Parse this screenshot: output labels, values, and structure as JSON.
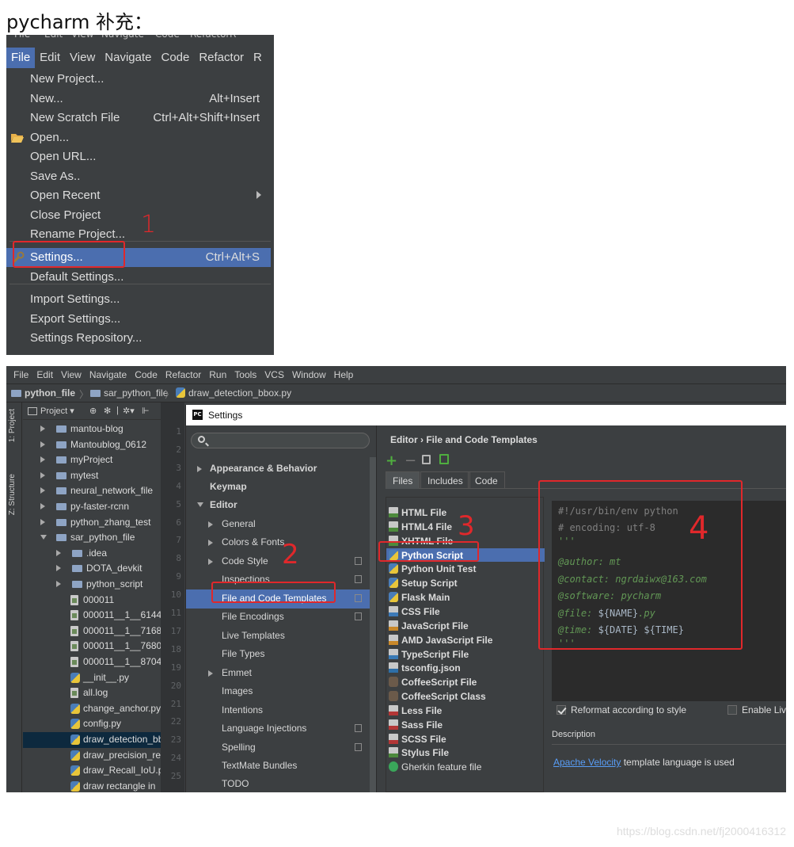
{
  "heading": "pycharm 补充：",
  "menu": {
    "strip_fragments": [
      "File",
      "Edit",
      "View",
      "Navigate",
      "Code",
      "Refactor",
      "R"
    ],
    "bar": [
      "File",
      "Edit",
      "View",
      "Navigate",
      "Code",
      "Refactor",
      "R"
    ],
    "items": [
      {
        "label": "New Project...",
        "shortcut": ""
      },
      {
        "label": "New...",
        "shortcut": "Alt+Insert"
      },
      {
        "label": "New Scratch File",
        "shortcut": "Ctrl+Alt+Shift+Insert"
      },
      {
        "label": "Open...",
        "shortcut": ""
      },
      {
        "label": "Open URL...",
        "shortcut": ""
      },
      {
        "label": "Save As..",
        "shortcut": ""
      },
      {
        "label": "Open Recent",
        "shortcut": ""
      },
      {
        "label": "Close Project",
        "shortcut": ""
      },
      {
        "label": "Rename Project...",
        "shortcut": ""
      },
      {
        "label": "Settings...",
        "shortcut": "Ctrl+Alt+S"
      },
      {
        "label": "Default Settings...",
        "shortcut": ""
      },
      {
        "label": "Import Settings...",
        "shortcut": ""
      },
      {
        "label": "Export Settings...",
        "shortcut": ""
      },
      {
        "label": "Settings Repository...",
        "shortcut": ""
      }
    ]
  },
  "annotations": {
    "a1": "1",
    "a2": "2",
    "a3": "3",
    "a4": "4"
  },
  "ide": {
    "menubar": [
      "File",
      "Edit",
      "View",
      "Navigate",
      "Code",
      "Refactor",
      "Run",
      "Tools",
      "VCS",
      "Window",
      "Help"
    ],
    "breadcrumb": [
      "python_file",
      "sar_python_file",
      "draw_detection_bbox.py"
    ],
    "side_tabs": [
      "1: Project",
      "Z: Structure"
    ],
    "project_toolbar": "Project ▾",
    "tree": [
      {
        "name": "mantou-blog",
        "kind": "folder",
        "indent": 0,
        "open": false
      },
      {
        "name": "Mantoublog_0612",
        "kind": "folder",
        "indent": 0,
        "open": false
      },
      {
        "name": "myProject",
        "kind": "folder",
        "indent": 0,
        "open": false
      },
      {
        "name": "mytest",
        "kind": "folder",
        "indent": 0,
        "open": false
      },
      {
        "name": "neural_network_file",
        "kind": "folder",
        "indent": 0,
        "open": false
      },
      {
        "name": "py-faster-rcnn",
        "kind": "folder",
        "indent": 0,
        "open": false
      },
      {
        "name": "python_zhang_test",
        "kind": "folder",
        "indent": 0,
        "open": false
      },
      {
        "name": "sar_python_file",
        "kind": "folder",
        "indent": 0,
        "open": true
      },
      {
        "name": ".idea",
        "kind": "folder",
        "indent": 1,
        "open": false
      },
      {
        "name": "DOTA_devkit",
        "kind": "folder",
        "indent": 1,
        "open": false
      },
      {
        "name": "python_script",
        "kind": "folder",
        "indent": 1,
        "open": false
      },
      {
        "name": "000011",
        "kind": "file",
        "indent": 1
      },
      {
        "name": "000011__1__6144_",
        "kind": "file",
        "indent": 1
      },
      {
        "name": "000011__1__7168_",
        "kind": "file",
        "indent": 1
      },
      {
        "name": "000011__1__7680_",
        "kind": "file",
        "indent": 1
      },
      {
        "name": "000011__1__8704_",
        "kind": "file",
        "indent": 1
      },
      {
        "name": "__init__.py",
        "kind": "py",
        "indent": 1
      },
      {
        "name": "all.log",
        "kind": "file",
        "indent": 1
      },
      {
        "name": "change_anchor.py",
        "kind": "py",
        "indent": 1
      },
      {
        "name": "config.py",
        "kind": "py",
        "indent": 1
      },
      {
        "name": "draw_detection_bb",
        "kind": "py",
        "indent": 1,
        "selected": true
      },
      {
        "name": "draw_precision_re",
        "kind": "py",
        "indent": 1
      },
      {
        "name": "draw_Recall_IoU.p",
        "kind": "py",
        "indent": 1
      },
      {
        "name": "draw rectangle in",
        "kind": "py",
        "indent": 1
      }
    ],
    "gutter": [
      "1",
      "2",
      "3",
      "4",
      "5",
      "6",
      "7",
      "8",
      "9",
      "10",
      "11",
      "17",
      "18",
      "19",
      "20",
      "21",
      "22",
      "23",
      "24",
      "25"
    ]
  },
  "settings": {
    "title": "Settings",
    "search_placeholder": "",
    "nav": [
      {
        "label": "Appearance & Behavior",
        "level": 0,
        "bold": true,
        "arrow": "r"
      },
      {
        "label": "Keymap",
        "level": 0,
        "bold": true
      },
      {
        "label": "Editor",
        "level": 0,
        "bold": true,
        "arrow": "d"
      },
      {
        "label": "General",
        "level": 1,
        "arrow": "r"
      },
      {
        "label": "Colors & Fonts",
        "level": 1,
        "arrow": "r"
      },
      {
        "label": "Code Style",
        "level": 1,
        "arrow": "r",
        "copy": true
      },
      {
        "label": "Inspections",
        "level": 1,
        "copy": true
      },
      {
        "label": "File and Code Templates",
        "level": 1,
        "copy": true,
        "selected": true
      },
      {
        "label": "File Encodings",
        "level": 1,
        "copy": true
      },
      {
        "label": "Live Templates",
        "level": 1
      },
      {
        "label": "File Types",
        "level": 1
      },
      {
        "label": "Emmet",
        "level": 1,
        "arrow": "r"
      },
      {
        "label": "Images",
        "level": 1
      },
      {
        "label": "Intentions",
        "level": 1
      },
      {
        "label": "Language Injections",
        "level": 1,
        "copy": true
      },
      {
        "label": "Spelling",
        "level": 1,
        "copy": true
      },
      {
        "label": "TextMate Bundles",
        "level": 1
      },
      {
        "label": "TODO",
        "level": 1
      }
    ],
    "header": "Editor › File and Code Templates",
    "tabs": [
      "Files",
      "Includes",
      "Code"
    ],
    "templates": [
      {
        "label": "HTML File",
        "icon": "html"
      },
      {
        "label": "HTML4 File",
        "icon": "html"
      },
      {
        "label": "XHTML File",
        "icon": "html"
      },
      {
        "label": "Python Script",
        "icon": "py",
        "selected": true
      },
      {
        "label": "Python Unit Test",
        "icon": "py"
      },
      {
        "label": "Setup Script",
        "icon": "py"
      },
      {
        "label": "Flask Main",
        "icon": "py"
      },
      {
        "label": "CSS File",
        "icon": "css"
      },
      {
        "label": "JavaScript File",
        "icon": "js"
      },
      {
        "label": "AMD JavaScript File",
        "icon": "js"
      },
      {
        "label": "TypeScript File",
        "icon": "ts"
      },
      {
        "label": "tsconfig.json",
        "icon": "json"
      },
      {
        "label": "CoffeeScript File",
        "icon": "coffee"
      },
      {
        "label": "CoffeeScript Class",
        "icon": "coffee"
      },
      {
        "label": "Less File",
        "icon": "less"
      },
      {
        "label": "Sass File",
        "icon": "less"
      },
      {
        "label": "SCSS File",
        "icon": "less"
      },
      {
        "label": "Stylus File",
        "icon": "styl"
      },
      {
        "label": "Gherkin feature file",
        "icon": "gherkin",
        "plain": true
      }
    ],
    "code": {
      "l1": "#!/usr/bin/env python",
      "l2": "# encoding: utf-8",
      "l3": "'''",
      "l4": "@author: mt",
      "l5": "@contact: ngrdaiwx@163.com",
      "l6": "@software: pycharm",
      "l7a": "@file: ",
      "l7b": "${NAME}",
      "l7c": ".py",
      "l8a": "@time: ",
      "l8b": "${DATE} ${TIME}",
      "l9": "'''"
    },
    "reformat_label": "Reformat according to style",
    "enable_label": "Enable Liv",
    "description_label": "Description",
    "desc_link": "Apache Velocity",
    "desc_rest": " template language is used"
  },
  "watermark": "https://blog.csdn.net/fj2000416312",
  "colors": {
    "accent": "#4b6eaf",
    "annotation_red": "#e0282b",
    "ide_bg": "#3c3f41"
  }
}
